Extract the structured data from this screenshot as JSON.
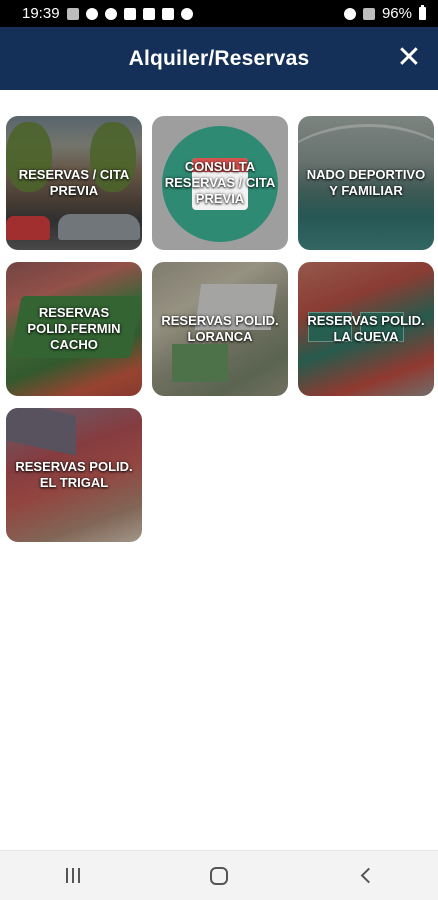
{
  "status_bar": {
    "time": "19:39",
    "battery_percent": "96%",
    "left_icons": [
      "missed-call-icon",
      "messenger-icon",
      "account-icon",
      "image-icon",
      "mail-icon",
      "youtube-icon",
      "vpn-icon"
    ],
    "right_icons": [
      "alarm-icon",
      "signal-icon",
      "battery-icon"
    ]
  },
  "header": {
    "title": "Alquiler/Reservas",
    "close_icon": "close-icon",
    "background_color": "#143058"
  },
  "tiles": [
    {
      "label": "RESERVAS / CITA PREVIA"
    },
    {
      "label": "CONSULTA RESERVAS / CITA PREVIA"
    },
    {
      "label": "NADO DEPORTIVO Y FAMILIAR"
    },
    {
      "label": "RESERVAS POLID.FERMIN CACHO"
    },
    {
      "label": "RESERVAS POLID. LORANCA"
    },
    {
      "label": "RESERVAS POLID. LA CUEVA"
    },
    {
      "label": "RESERVAS POLID. EL TRIGAL"
    }
  ],
  "nav_bar": {
    "buttons": [
      "recent-apps-icon",
      "home-icon",
      "back-icon"
    ]
  }
}
